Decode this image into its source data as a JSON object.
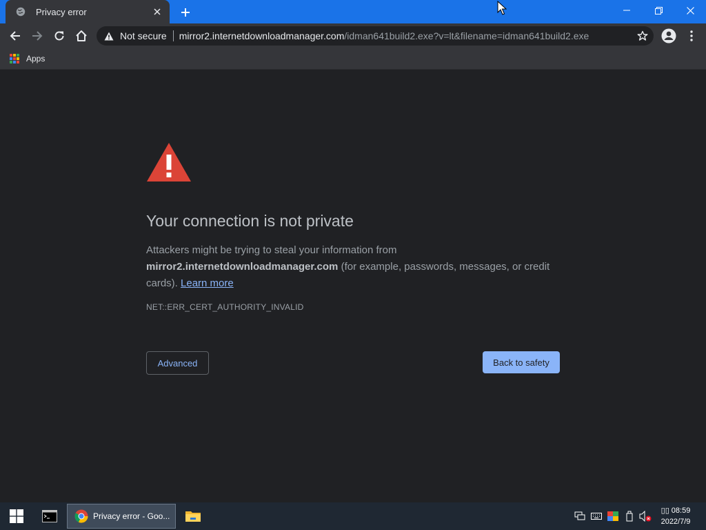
{
  "browser": {
    "tab_title": "Privacy error",
    "omnibox": {
      "security_label": "Not secure",
      "host": "mirror2.internetdownloadmanager.com",
      "path": "/idman641build2.exe?v=lt&filename=idman641build2.exe"
    },
    "bookmarks": {
      "apps_label": "Apps"
    }
  },
  "page": {
    "heading": "Your connection is not private",
    "intro": "Attackers might be trying to steal your information from",
    "domain": "mirror2.internetdownloadmanager.com",
    "details": "(for example, passwords, messages, or credit cards).",
    "learn_more": "Learn more",
    "error_code": "NET::ERR_CERT_AUTHORITY_INVALID",
    "advanced_button": "Advanced",
    "back_button": "Back to safety"
  },
  "taskbar": {
    "chrome_label": "Privacy error - Goo...",
    "clock_time": "▯▯ 08:59",
    "clock_date": "2022/7/9"
  },
  "colors": {
    "titlebar": "#1a73e8",
    "background": "#202124",
    "warning_red": "#db4437",
    "link_blue": "#8ab4f8"
  },
  "icons": [
    "globe-icon",
    "close-icon",
    "plus-icon",
    "minimize-icon",
    "restore-icon",
    "back-arrow-icon",
    "forward-arrow-icon",
    "reload-icon",
    "home-icon",
    "warning-triangle-icon",
    "star-icon",
    "account-icon",
    "kebab-menu-icon",
    "apps-grid-icon",
    "windows-logo-icon",
    "terminal-icon",
    "chrome-icon",
    "folder-icon",
    "network-icon",
    "keyboard-icon",
    "color-icon",
    "usb-icon",
    "volume-muted-icon"
  ]
}
